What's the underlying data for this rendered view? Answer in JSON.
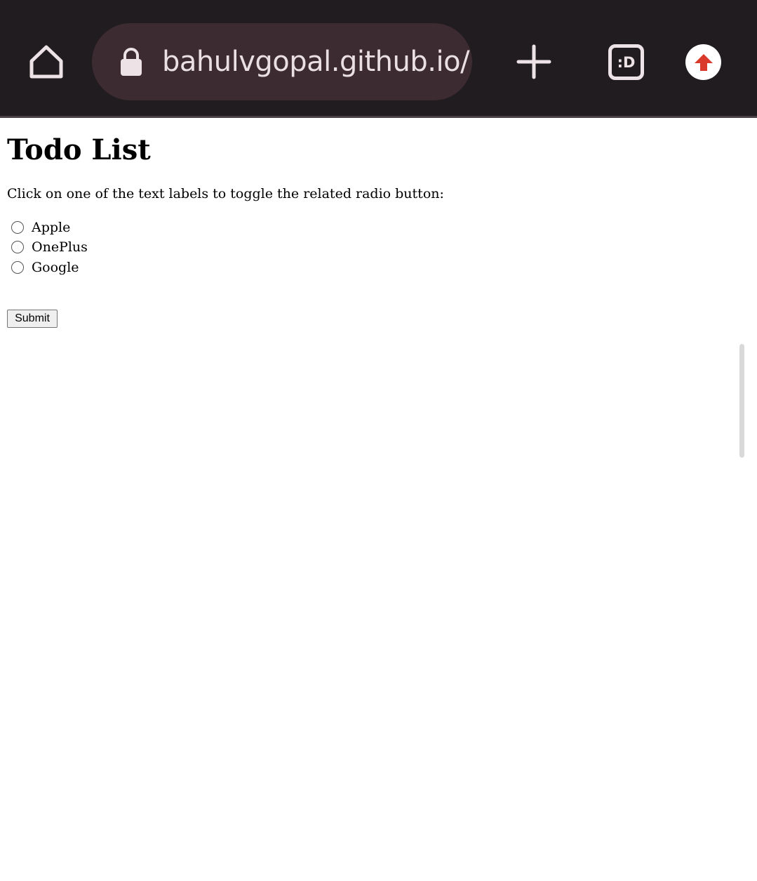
{
  "browser": {
    "url": "bahulvgopal.github.io/",
    "tabs_label": ":D",
    "icons": {
      "home": "home-icon",
      "lock": "lock-icon",
      "new_tab": "plus-icon",
      "tabs": "tabs-icon",
      "menu": "arrow-up-icon"
    },
    "colors": {
      "toolbar_bg": "#211c1f",
      "url_bar_bg": "#3c2b30",
      "menu_arrow": "#d93a2b"
    }
  },
  "page": {
    "title": "Todo List",
    "instruction": "Click on one of the text labels to toggle the related radio button:",
    "options": [
      {
        "label": "Apple",
        "checked": false
      },
      {
        "label": "OnePlus",
        "checked": false
      },
      {
        "label": "Google",
        "checked": false
      }
    ],
    "submit_label": "Submit"
  }
}
